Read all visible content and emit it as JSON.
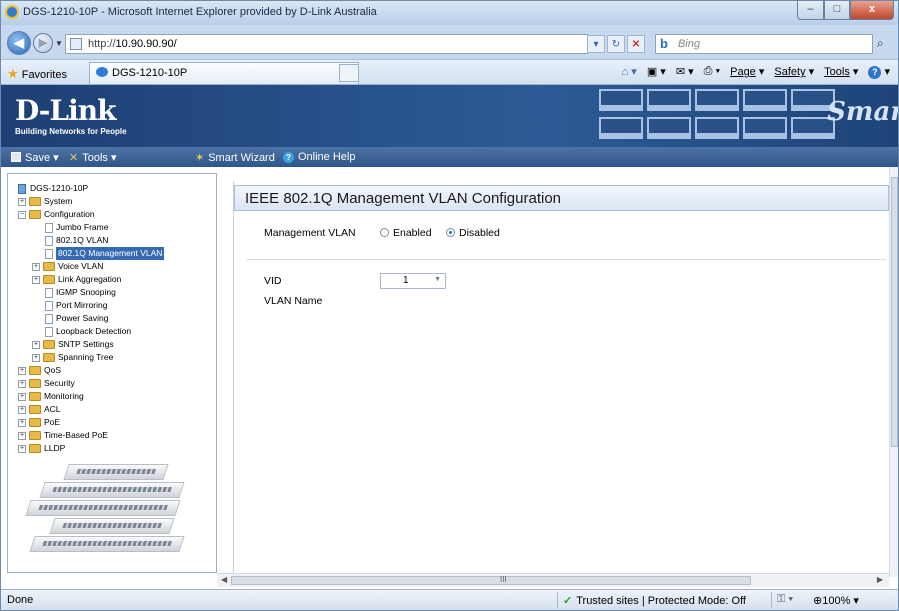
{
  "window": {
    "title": "DGS-1210-10P - Microsoft Internet Explorer provided by D-Link Australia",
    "min_label": "–",
    "max_label": "□",
    "close_label": "x"
  },
  "address": {
    "url_prefix": "http://",
    "url_host": "10.90.90.90/",
    "search_placeholder": "Bing"
  },
  "favorites": {
    "label": "Favorites",
    "tab_title": "DGS-1210-10P",
    "page_label": "Page",
    "safety_label": "Safety",
    "tools_label": "Tools"
  },
  "banner": {
    "brand": "D-Link",
    "tagline": "Building Networks for People",
    "smart": "Smar"
  },
  "toolbar": {
    "save": "Save",
    "tools": "Tools",
    "wizard": "Smart Wizard",
    "help": "Online Help"
  },
  "tree": {
    "root": "DGS-1210-10P",
    "system": "System",
    "configuration": "Configuration",
    "jumbo": "Jumbo Frame",
    "vlan": "802.1Q VLAN",
    "mgmt_vlan": "802.1Q Management VLAN",
    "voice": "Voice VLAN",
    "link_agg": "Link Aggregation",
    "igmp": "IGMP Snooping",
    "mirror": "Port Mirroring",
    "power": "Power Saving",
    "loopback": "Loopback Detection",
    "sntp": "SNTP Settings",
    "stp": "Spanning Tree",
    "qos": "QoS",
    "security": "Security",
    "monitoring": "Monitoring",
    "acl": "ACL",
    "poe": "PoE",
    "time_poe": "Time-Based PoE",
    "lldp": "LLDP"
  },
  "panel": {
    "title": "IEEE 802.1Q Management VLAN Configuration",
    "mgmt_label": "Management VLAN",
    "enabled": "Enabled",
    "disabled": "Disabled",
    "selected": "disabled",
    "vid_label": "VID",
    "vid_value": "1",
    "vlan_name_label": "VLAN Name"
  },
  "status": {
    "text": "Done",
    "zone": "Trusted sites | Protected Mode: Off",
    "zoom": "100%"
  },
  "colors": {
    "banner": "#2d5b96",
    "selection": "#3469b4"
  }
}
